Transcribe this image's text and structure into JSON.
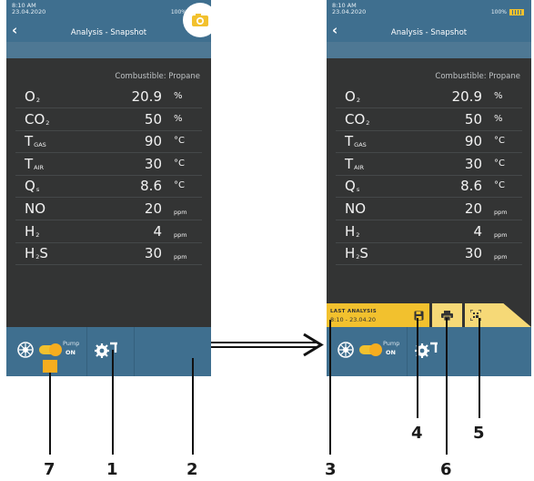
{
  "status": {
    "time": "8:10 AM",
    "date": "23.04.2020",
    "battery_pct": "100%"
  },
  "header": {
    "back_icon": "chevron-left-icon",
    "title": "Analysis - Snapshot"
  },
  "combustible": "Combustible: Propane",
  "measurements": [
    {
      "name": "O",
      "sub": "2",
      "value": "20.9",
      "unit": "%"
    },
    {
      "name": "CO",
      "sub": "2",
      "value": "50",
      "unit": "%"
    },
    {
      "name": "T",
      "sub": "GAS",
      "value": "90",
      "unit": "°C"
    },
    {
      "name": "T",
      "sub": "AIR",
      "value": "30",
      "unit": "°C"
    },
    {
      "name": "Q",
      "sub": "s",
      "value": "8.6",
      "unit": "°C"
    },
    {
      "name": "NO",
      "sub": "",
      "value": "20",
      "unit": "ppm"
    },
    {
      "name": "H",
      "sub": "2",
      "value": "4",
      "unit": "ppm"
    },
    {
      "name": "H",
      "sub": "2",
      "suffix": "S",
      "value": "30",
      "unit": "ppm"
    }
  ],
  "bottom": {
    "pump_label": "Pump",
    "pump_state": "ON"
  },
  "snapshot_bar": {
    "last_analysis_title": "LAST ANALYSIS",
    "last_analysis_value": "8:10 - 23.04.20"
  },
  "callouts": [
    "1",
    "2",
    "3",
    "4",
    "5",
    "6",
    "7"
  ],
  "colors": {
    "screen_bg": "#333434",
    "header_blue": "#3f6f8f",
    "accent_yellow": "#f2c12e"
  }
}
